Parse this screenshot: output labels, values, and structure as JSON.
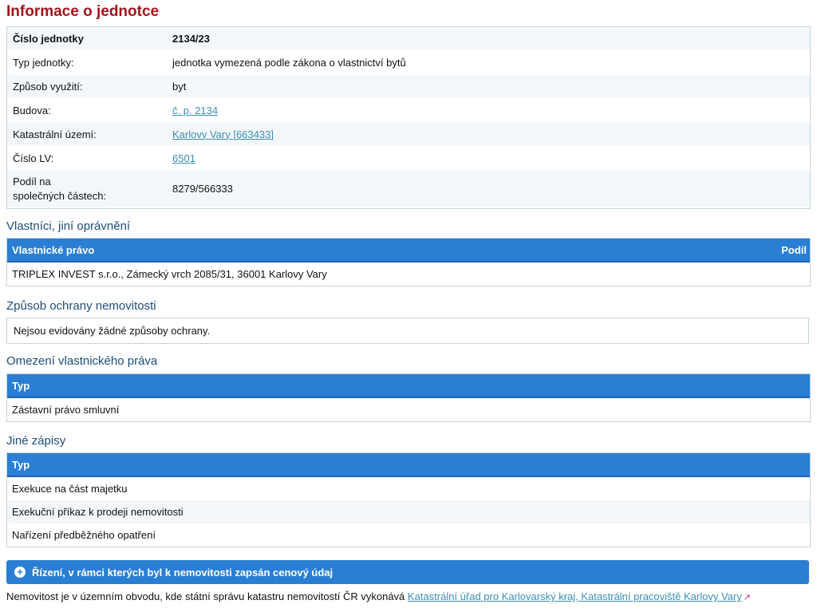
{
  "title": "Informace o jednotce",
  "info": {
    "rows": [
      {
        "label": "Číslo jednotky",
        "value": "2134/23"
      },
      {
        "label": "Typ jednotky:",
        "value": "jednotka vymezená podle zákona o vlastnictví bytů"
      },
      {
        "label": "Způsob využití:",
        "value": "byt"
      },
      {
        "label": "Budova:",
        "value": "č. p. 2134"
      },
      {
        "label": "Katastrální území:",
        "value": "Karlovy Vary [663433]"
      },
      {
        "label": "Číslo LV:",
        "value": "6501"
      },
      {
        "label_line1": "Podíl na",
        "label_line2": "společných částech:",
        "value": "8279/566333"
      }
    ]
  },
  "owners": {
    "title": "Vlastníci, jiní oprávnění",
    "col_right": "Vlastnické právo",
    "col_share": "Podíl",
    "rows": [
      "TRIPLEX INVEST s.r.o., Zámecký vrch 2085/31, 36001 Karlovy Vary"
    ]
  },
  "protection": {
    "title": "Způsob ochrany nemovitosti",
    "text": "Nejsou evidovány žádné způsoby ochrany."
  },
  "restrictions": {
    "title": "Omezení vlastnického práva",
    "col_type": "Typ",
    "rows": [
      "Zástavní právo smluvní"
    ]
  },
  "other": {
    "title": "Jiné zápisy",
    "col_type": "Typ",
    "rows": [
      "Exekuce na část majetku",
      "Exekuční příkaz k prodeji nemovitosti",
      "Nařízení předběžného opatření"
    ]
  },
  "proceedings": {
    "label": "Řízení, v rámci kterých byl k nemovitosti zapsán cenový údaj"
  },
  "footer": {
    "text": "Nemovitost je v územním obvodu, kde státní správu katastru nemovitostí ČR vykonává",
    "link": "Katastrální úřad pro Karlovarský kraj, Katastrální pracoviště Karlovy Vary"
  },
  "icons": [
    "plus-circle-icon",
    "external-link-icon"
  ],
  "colors": {
    "title": "#a0141e",
    "section_title": "#1c4d7a",
    "header_blue": "#2a7fd4",
    "link": "#3c8fb0"
  }
}
